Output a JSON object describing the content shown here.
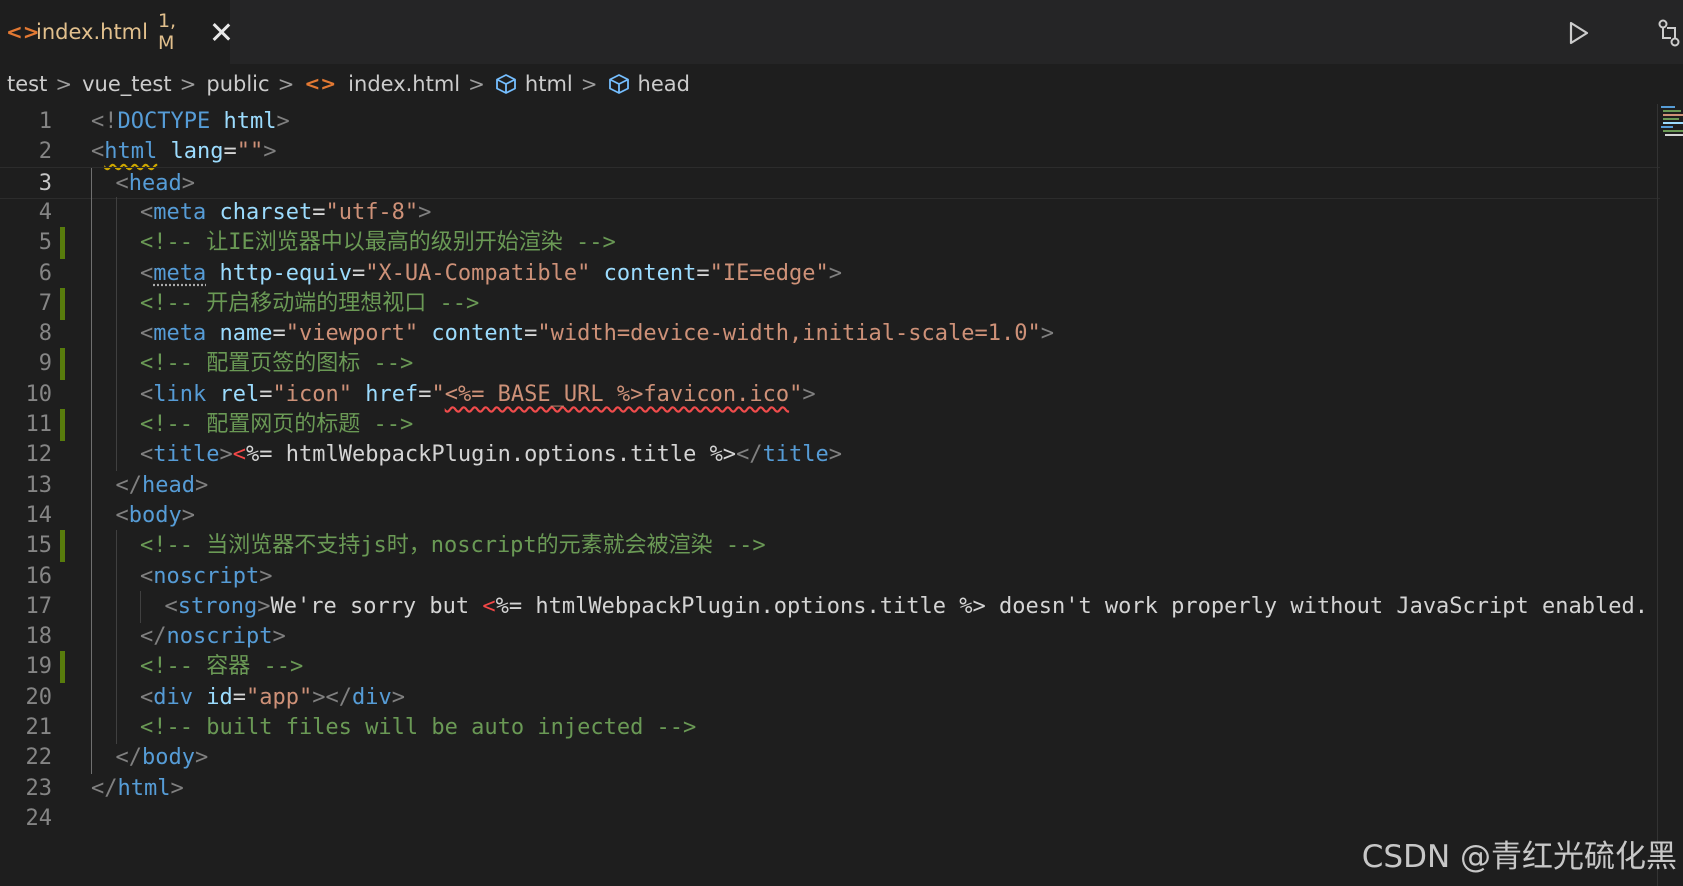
{
  "tab": {
    "icon": "html-file-icon",
    "name": "index.html",
    "meta": "1, M"
  },
  "breadcrumb": [
    "test",
    "vue_test",
    "public",
    "index.html",
    "html",
    "head"
  ],
  "editor": {
    "active_line": 3,
    "lines": [
      {
        "n": "1",
        "indent": 0,
        "mod": false,
        "segments": [
          [
            "p",
            "<!"
          ],
          [
            "t",
            "DOCTYPE"
          ],
          [
            "x",
            " "
          ],
          [
            "a",
            "html"
          ],
          [
            "p",
            ">"
          ]
        ]
      },
      {
        "n": "2",
        "indent": 0,
        "mod": false,
        "segments": [
          [
            "p",
            "<"
          ],
          [
            "t_warn",
            "html"
          ],
          [
            "x",
            " "
          ],
          [
            "a",
            "lang"
          ],
          [
            "x",
            "="
          ],
          [
            "s",
            "\"\""
          ],
          [
            "p",
            ">"
          ]
        ]
      },
      {
        "n": "3",
        "indent": 1,
        "mod": false,
        "segments": [
          [
            "p",
            "<"
          ],
          [
            "t",
            "head"
          ],
          [
            "p",
            ">"
          ]
        ]
      },
      {
        "n": "4",
        "indent": 2,
        "mod": false,
        "segments": [
          [
            "p",
            "<"
          ],
          [
            "t",
            "meta"
          ],
          [
            "x",
            " "
          ],
          [
            "a",
            "charset"
          ],
          [
            "x",
            "="
          ],
          [
            "s",
            "\"utf-8\""
          ],
          [
            "p",
            ">"
          ]
        ]
      },
      {
        "n": "5",
        "indent": 2,
        "mod": true,
        "segments": [
          [
            "c",
            "<!-- 让IE浏览器中以最高的级别开始渲染 -->"
          ]
        ]
      },
      {
        "n": "6",
        "indent": 2,
        "mod": false,
        "segments": [
          [
            "p",
            "<"
          ],
          [
            "t_dots",
            "meta"
          ],
          [
            "x",
            " "
          ],
          [
            "a",
            "http-equiv"
          ],
          [
            "x",
            "="
          ],
          [
            "s",
            "\"X-UA-Compatible\""
          ],
          [
            "x",
            " "
          ],
          [
            "a",
            "content"
          ],
          [
            "x",
            "="
          ],
          [
            "s",
            "\"IE=edge\""
          ],
          [
            "p",
            ">"
          ]
        ]
      },
      {
        "n": "7",
        "indent": 2,
        "mod": true,
        "segments": [
          [
            "c",
            "<!-- 开启移动端的理想视口 -->"
          ]
        ]
      },
      {
        "n": "8",
        "indent": 2,
        "mod": false,
        "segments": [
          [
            "p",
            "<"
          ],
          [
            "t",
            "meta"
          ],
          [
            "x",
            " "
          ],
          [
            "a",
            "name"
          ],
          [
            "x",
            "="
          ],
          [
            "s",
            "\"viewport\""
          ],
          [
            "x",
            " "
          ],
          [
            "a",
            "content"
          ],
          [
            "x",
            "="
          ],
          [
            "s",
            "\"width=device-width,initial-scale=1.0\""
          ],
          [
            "p",
            ">"
          ]
        ]
      },
      {
        "n": "9",
        "indent": 2,
        "mod": true,
        "segments": [
          [
            "c",
            "<!-- 配置页签的图标 -->"
          ]
        ]
      },
      {
        "n": "10",
        "indent": 2,
        "mod": false,
        "segments": [
          [
            "p",
            "<"
          ],
          [
            "t",
            "link"
          ],
          [
            "x",
            " "
          ],
          [
            "a",
            "rel"
          ],
          [
            "x",
            "="
          ],
          [
            "s",
            "\"icon\""
          ],
          [
            "x",
            " "
          ],
          [
            "a",
            "href"
          ],
          [
            "x",
            "="
          ],
          [
            "s",
            "\""
          ],
          [
            "s_err",
            "<%= BASE_URL %>favicon.ico"
          ],
          [
            "s",
            "\""
          ],
          [
            "p",
            ">"
          ]
        ]
      },
      {
        "n": "11",
        "indent": 2,
        "mod": true,
        "segments": [
          [
            "c",
            "<!-- 配置网页的标题 -->"
          ]
        ]
      },
      {
        "n": "12",
        "indent": 2,
        "mod": false,
        "segments": [
          [
            "p",
            "<"
          ],
          [
            "t",
            "title"
          ],
          [
            "p",
            ">"
          ],
          [
            "r",
            "<"
          ],
          [
            "x",
            "%= htmlWebpackPlugin.options.title %>"
          ],
          [
            "p",
            "</"
          ],
          [
            "t",
            "title"
          ],
          [
            "p",
            ">"
          ]
        ]
      },
      {
        "n": "13",
        "indent": 1,
        "mod": false,
        "segments": [
          [
            "p",
            "</"
          ],
          [
            "t",
            "head"
          ],
          [
            "p",
            ">"
          ]
        ]
      },
      {
        "n": "14",
        "indent": 1,
        "mod": false,
        "segments": [
          [
            "p",
            "<"
          ],
          [
            "t",
            "body"
          ],
          [
            "p",
            ">"
          ]
        ]
      },
      {
        "n": "15",
        "indent": 2,
        "mod": true,
        "segments": [
          [
            "c",
            "<!-- 当浏览器不支持js时，noscript的元素就会被渲染 -->"
          ]
        ]
      },
      {
        "n": "16",
        "indent": 2,
        "mod": false,
        "segments": [
          [
            "p",
            "<"
          ],
          [
            "t",
            "noscript"
          ],
          [
            "p",
            ">"
          ]
        ]
      },
      {
        "n": "17",
        "indent": 3,
        "mod": false,
        "segments": [
          [
            "p",
            "<"
          ],
          [
            "t",
            "strong"
          ],
          [
            "p",
            ">"
          ],
          [
            "x",
            "We're sorry but "
          ],
          [
            "r",
            "<"
          ],
          [
            "x",
            "%= htmlWebpackPlugin.options.title %> doesn't work properly without JavaScript enabled."
          ]
        ]
      },
      {
        "n": "18",
        "indent": 2,
        "mod": false,
        "segments": [
          [
            "p",
            "</"
          ],
          [
            "t",
            "noscript"
          ],
          [
            "p",
            ">"
          ]
        ]
      },
      {
        "n": "19",
        "indent": 2,
        "mod": true,
        "segments": [
          [
            "c",
            "<!-- 容器 -->"
          ]
        ]
      },
      {
        "n": "20",
        "indent": 2,
        "mod": false,
        "segments": [
          [
            "p",
            "<"
          ],
          [
            "t",
            "div"
          ],
          [
            "x",
            " "
          ],
          [
            "a",
            "id"
          ],
          [
            "x",
            "="
          ],
          [
            "s",
            "\"app\""
          ],
          [
            "p",
            "></"
          ],
          [
            "t",
            "div"
          ],
          [
            "p",
            ">"
          ]
        ]
      },
      {
        "n": "21",
        "indent": 2,
        "mod": false,
        "segments": [
          [
            "c",
            "<!-- built files will be auto injected -->"
          ]
        ]
      },
      {
        "n": "22",
        "indent": 1,
        "mod": false,
        "segments": [
          [
            "p",
            "</"
          ],
          [
            "t",
            "body"
          ],
          [
            "p",
            ">"
          ]
        ]
      },
      {
        "n": "23",
        "indent": 0,
        "mod": false,
        "segments": [
          [
            "p",
            "</"
          ],
          [
            "t",
            "html"
          ],
          [
            "p",
            ">"
          ]
        ]
      },
      {
        "n": "24",
        "indent": 0,
        "mod": false,
        "segments": []
      }
    ]
  },
  "watermark": "CSDN @青红光硫化黑",
  "colors": {
    "tag": "#569cd6",
    "attribute": "#9cdcfe",
    "string": "#ce9178",
    "comment": "#6a9955",
    "punctuation": "#808080",
    "modified_gutter": "#587c0c",
    "file_icon": "#e37933",
    "modified_tab_text": "#e2c08d"
  }
}
